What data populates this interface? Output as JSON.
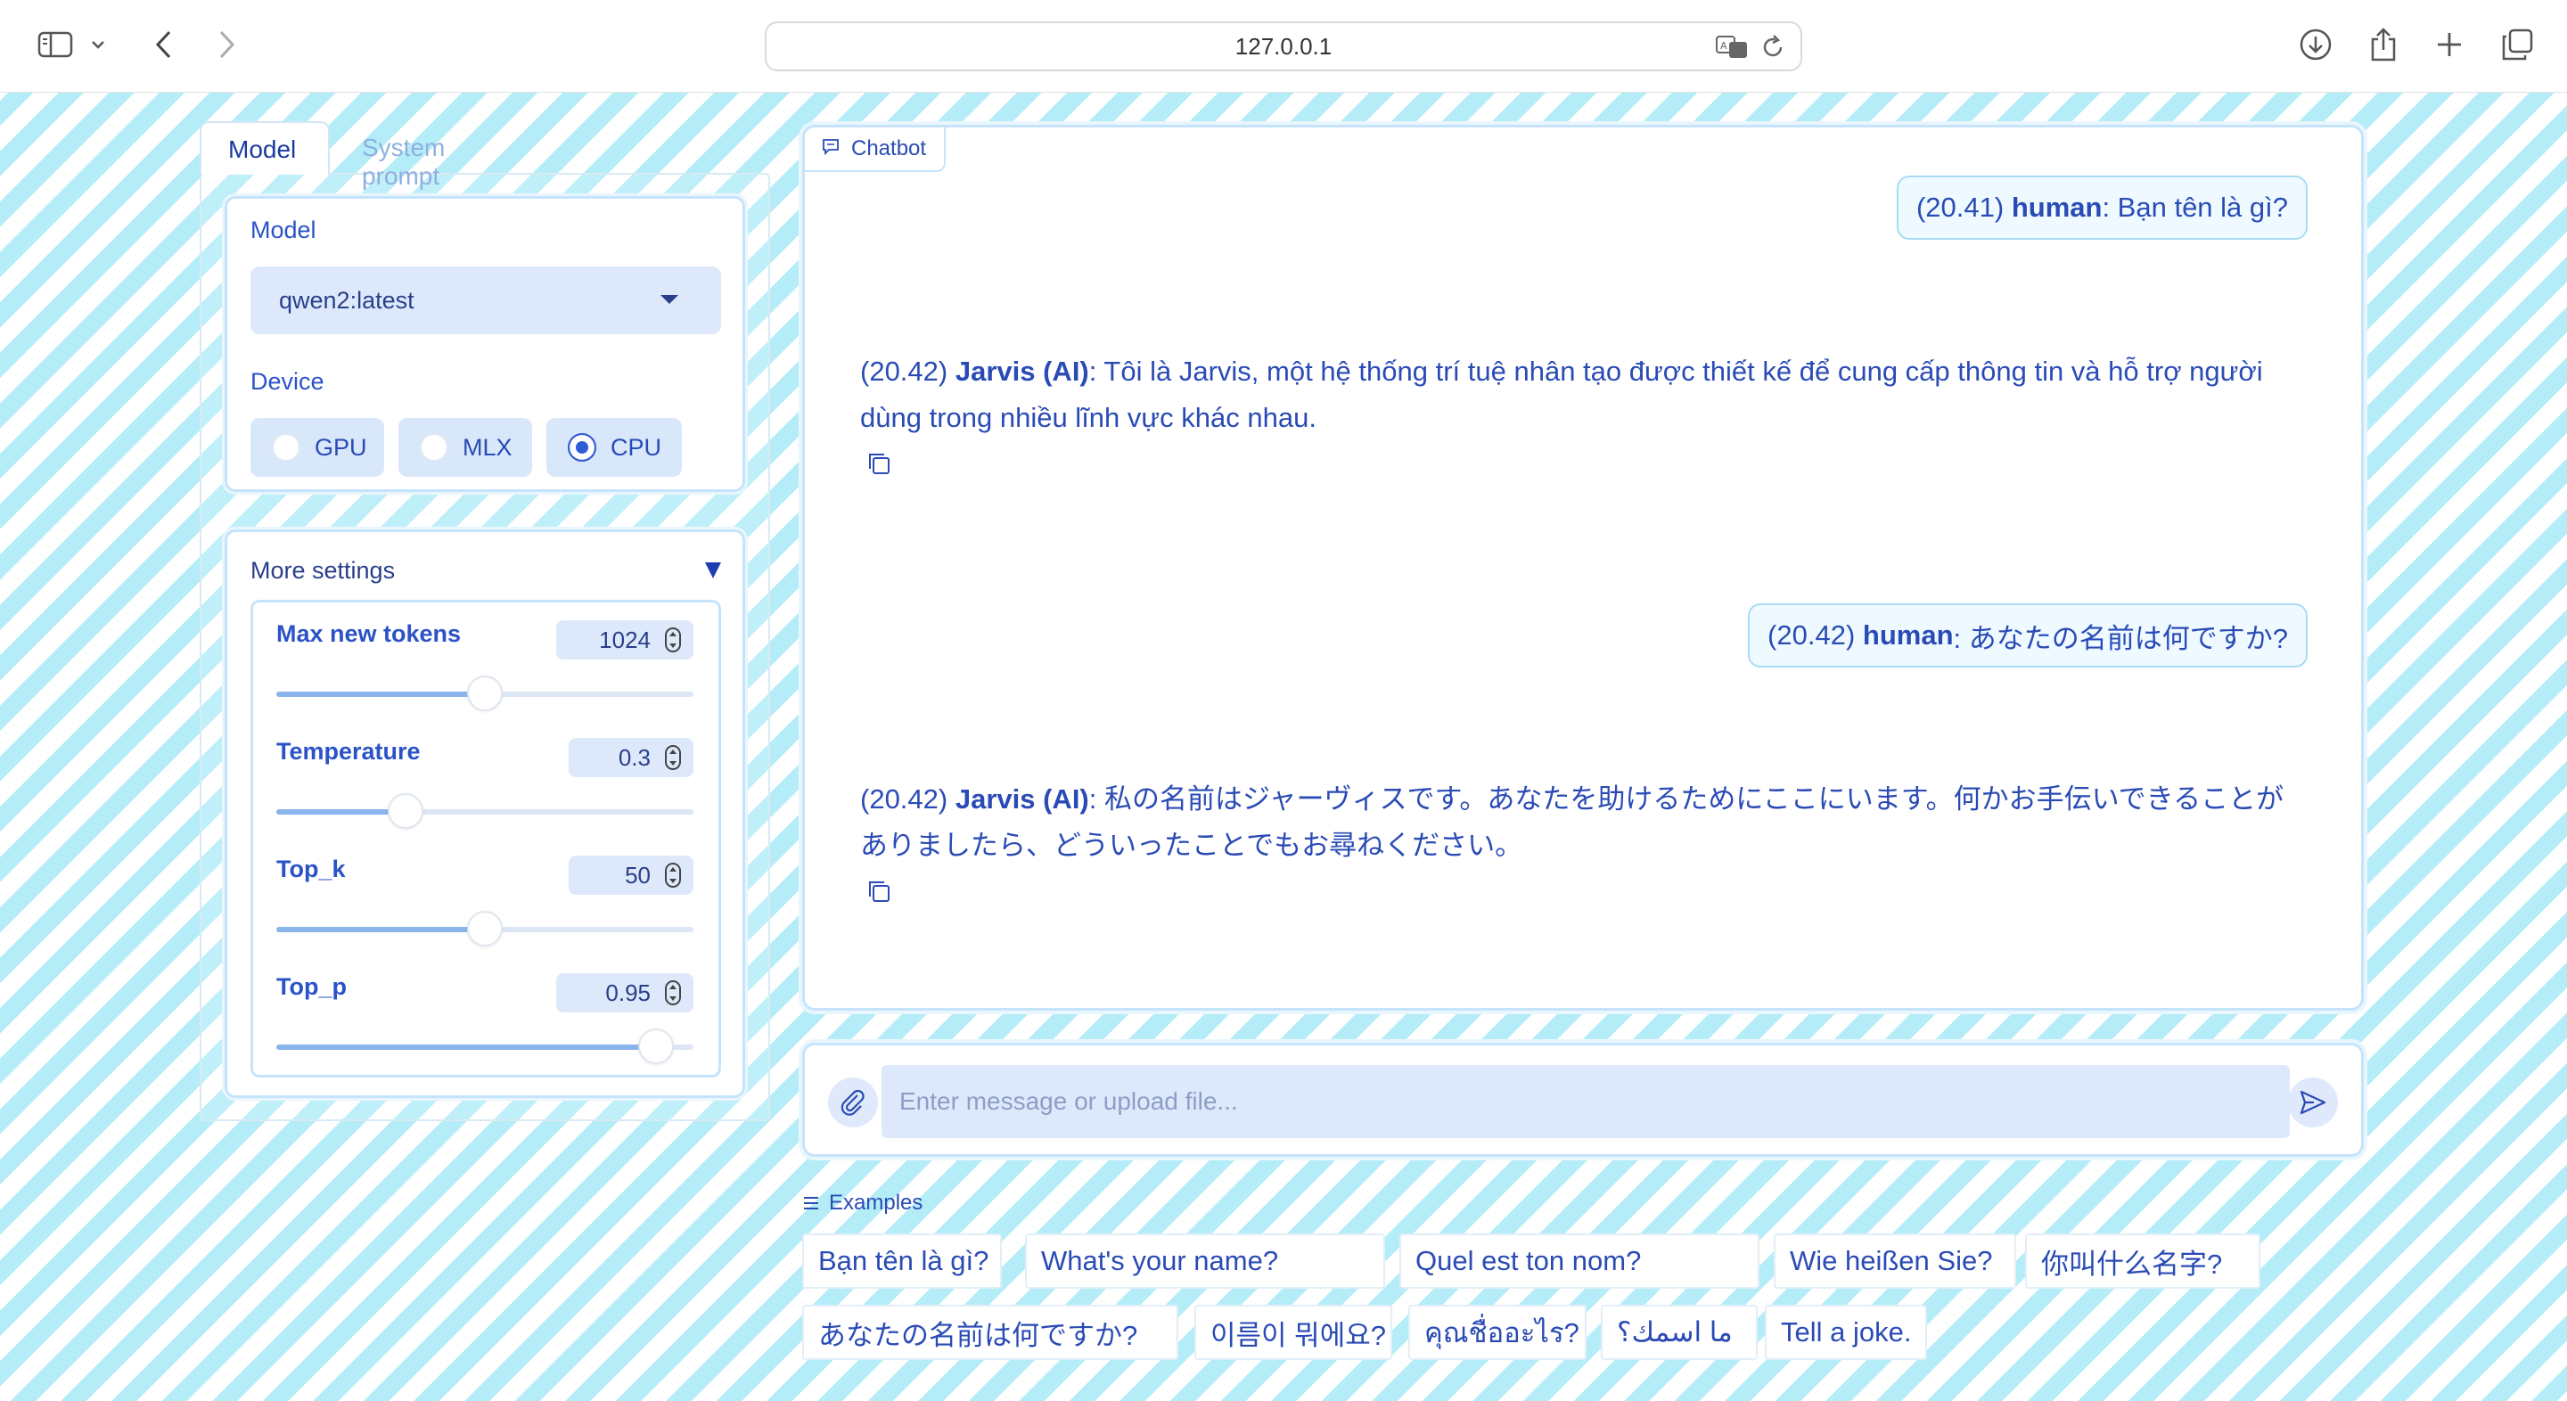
{
  "browser": {
    "url": "127.0.0.1",
    "icons": [
      "sidebar-icon",
      "chevron-down-icon",
      "back-icon",
      "forward-icon",
      "translate-icon",
      "reload-icon",
      "download-icon",
      "share-icon",
      "new-tab-icon",
      "tabs-overview-icon"
    ]
  },
  "tabs": {
    "model": "Model",
    "system_prompt": "System prompt"
  },
  "model_panel": {
    "model_label": "Model",
    "model_value": "qwen2:latest",
    "device_label": "Device",
    "devices": [
      {
        "label": "GPU",
        "selected": false
      },
      {
        "label": "MLX",
        "selected": false
      },
      {
        "label": "CPU",
        "selected": true
      }
    ]
  },
  "settings": {
    "title": "More settings",
    "sliders": [
      {
        "label": "Max new tokens",
        "value": "1024",
        "fraction": 0.5
      },
      {
        "label": "Temperature",
        "value": "0.3",
        "fraction": 0.31
      },
      {
        "label": "Top_k",
        "value": "50",
        "fraction": 0.5
      },
      {
        "label": "Top_p",
        "value": "0.95",
        "fraction": 0.91
      }
    ]
  },
  "chat": {
    "tag": "Chatbot",
    "messages": [
      {
        "role": "human",
        "time": "(20.41)",
        "speaker": "human",
        "text": ": Bạn tên là gì?"
      },
      {
        "role": "bot",
        "time": "(20.42)",
        "speaker": "Jarvis (AI)",
        "text": ": Tôi là Jarvis, một hệ thống trí tuệ nhân tạo được thiết kế để cung cấp thông tin và hỗ trợ người dùng trong nhiều lĩnh vực khác nhau."
      },
      {
        "role": "human",
        "time": "(20.42)",
        "speaker": "human",
        "text": ": あなたの名前は何ですか?"
      },
      {
        "role": "bot",
        "time": "(20.42)",
        "speaker": "Jarvis (AI)",
        "text": ": 私の名前はジャーヴィスです。あなたを助けるためにここにいます。何かお手伝いできることがありましたら、どういったことでもお尋ねください。"
      }
    ]
  },
  "input": {
    "placeholder": "Enter message or upload file..."
  },
  "examples": {
    "label": "Examples",
    "items": [
      "Bạn tên là gì?",
      "What's your name?",
      "Quel est ton nom?",
      "Wie heißen Sie?",
      "你叫什么名字?",
      "あなたの名前は何ですか?",
      "이름이 뭐에요?",
      "คุณชื่ออะไร?",
      "ما اسمك؟",
      "Tell a joke."
    ]
  },
  "colors": {
    "accent": "#2a4bb5",
    "stripe": "#b4edf8",
    "field": "#dde9fb",
    "border": "#c5e4fb"
  }
}
